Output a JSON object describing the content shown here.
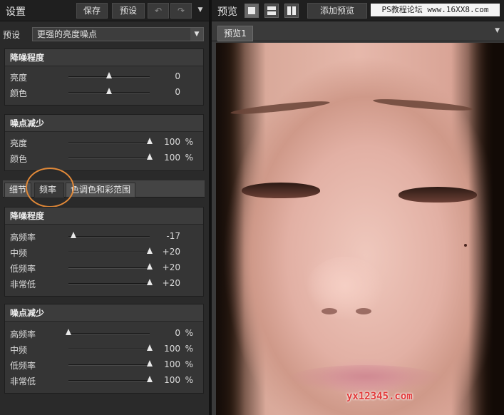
{
  "left_panel": {
    "title": "设置",
    "toolbar": {
      "save_label": "保存",
      "preset_label": "预设",
      "undo_icon": "↶",
      "redo_icon": "↷",
      "menu_icon": "▼"
    },
    "preset": {
      "label": "预设",
      "value": "更强的亮度噪点",
      "arrow": "▼"
    },
    "tabs": [
      {
        "label": "细节"
      },
      {
        "label": "频率"
      },
      {
        "label": "色调色和彩范围"
      }
    ],
    "sections": {
      "denoise_top": {
        "title": "降噪程度",
        "rows": [
          {
            "label": "亮度",
            "value": "0",
            "unit": "",
            "level": 0.5
          },
          {
            "label": "颜色",
            "value": "0",
            "unit": "",
            "level": 0.5
          }
        ]
      },
      "noise_reduce_top": {
        "title": "噪点减少",
        "rows": [
          {
            "label": "亮度",
            "value": "100",
            "unit": "%",
            "level": 1.0
          },
          {
            "label": "颜色",
            "value": "100",
            "unit": "%",
            "level": 1.0
          }
        ]
      },
      "denoise_freq": {
        "title": "降噪程度",
        "rows": [
          {
            "label": "高频率",
            "value": "-17",
            "unit": "",
            "level": 0.06
          },
          {
            "label": "中频",
            "value": "+20",
            "unit": "",
            "level": 1.0
          },
          {
            "label": "低频率",
            "value": "+20",
            "unit": "",
            "level": 1.0
          },
          {
            "label": "非常低",
            "value": "+20",
            "unit": "",
            "level": 1.0
          }
        ]
      },
      "noise_reduce_freq": {
        "title": "噪点减少",
        "rows": [
          {
            "label": "高频率",
            "value": "0",
            "unit": "%",
            "level": 0.0
          },
          {
            "label": "中频",
            "value": "100",
            "unit": "%",
            "level": 1.0
          },
          {
            "label": "低频率",
            "value": "100",
            "unit": "%",
            "level": 1.0
          },
          {
            "label": "非常低",
            "value": "100",
            "unit": "%",
            "level": 1.0
          }
        ]
      }
    }
  },
  "right_panel": {
    "title": "预览",
    "add_preview_label": "添加预览",
    "watermark_top": "PS教程论坛 www.16XX8.com",
    "preview_tab_label": "预览1",
    "more_icon": "▼",
    "watermark_bottom": "yx12345.com"
  },
  "colors": {
    "highlight_circle": "#e08838",
    "watermark_red": "#e23b3b"
  }
}
